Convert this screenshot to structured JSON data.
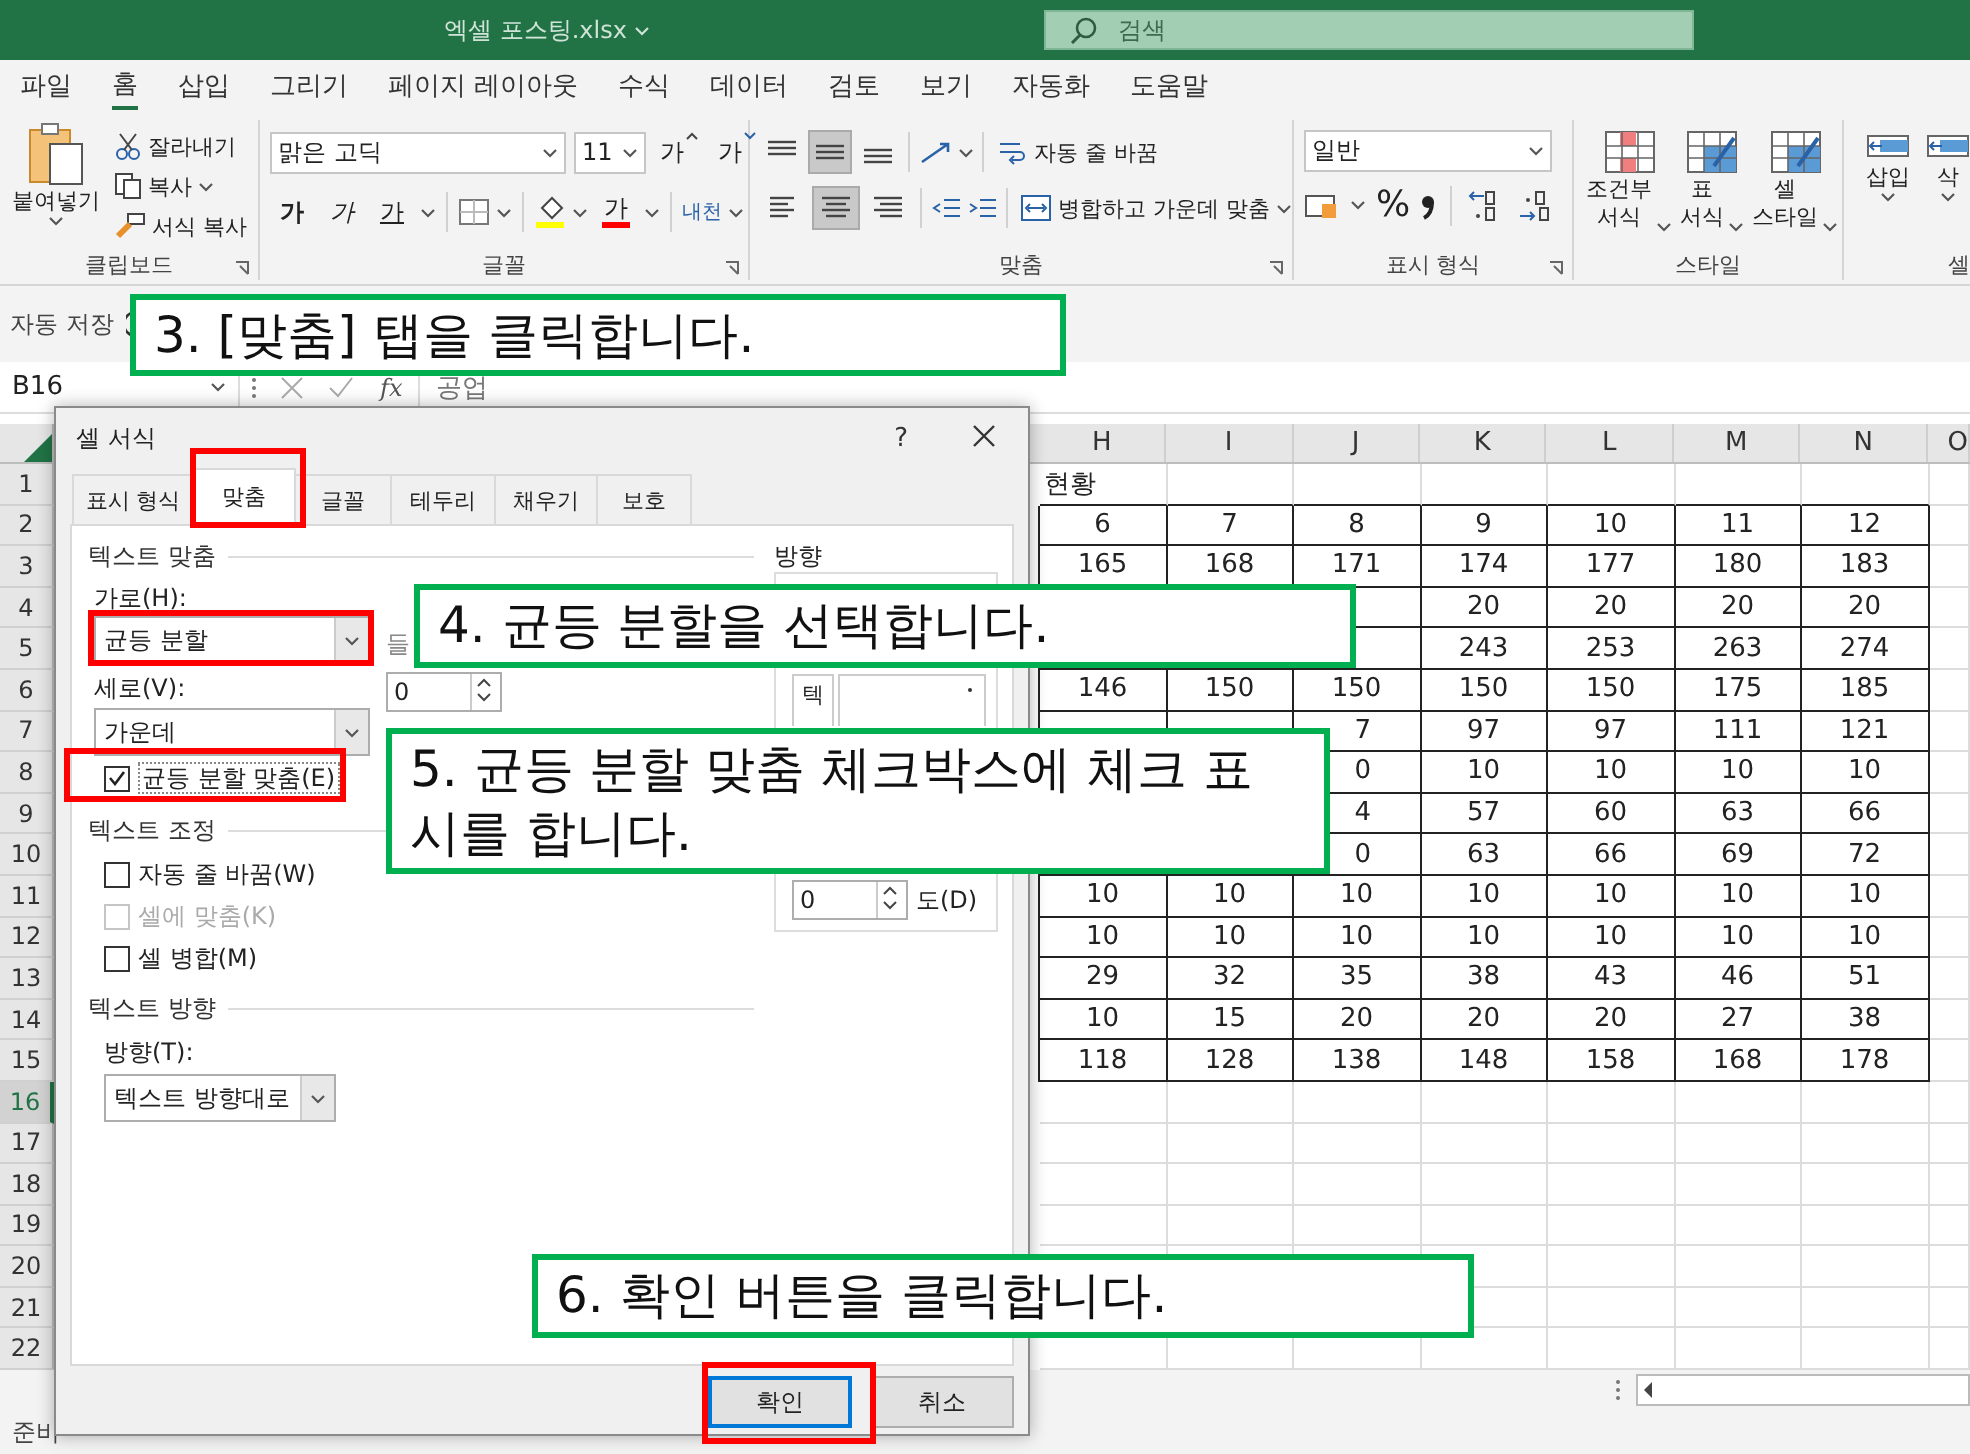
{
  "title_bar": {
    "file_name": "엑셀 포스팅.xlsx",
    "search": "검색"
  },
  "menu_tabs": [
    {
      "label": "파일",
      "selected": false
    },
    {
      "label": "홈",
      "selected": true
    },
    {
      "label": "삽입",
      "selected": false
    },
    {
      "label": "그리기",
      "selected": false
    },
    {
      "label": "페이지 레이아웃",
      "selected": false
    },
    {
      "label": "수식",
      "selected": false
    },
    {
      "label": "데이터",
      "selected": false
    },
    {
      "label": "검토",
      "selected": false
    },
    {
      "label": "보기",
      "selected": false
    },
    {
      "label": "자동화",
      "selected": false
    },
    {
      "label": "도움말",
      "selected": false
    }
  ],
  "ribbon": {
    "clipboard": {
      "label": "클립보드",
      "paste": "붙여넣기",
      "cut": "잘라내기",
      "copy": "복사",
      "format_painter": "서식 복사"
    },
    "font": {
      "label": "글꼴",
      "font_name": "맑은 고딕",
      "font_size": "11",
      "grow": "가",
      "shrink": "가",
      "bold": "가",
      "italic": "가",
      "underline": "가",
      "font_color": "가",
      "phonetic": "내천"
    },
    "alignment": {
      "label": "맞춤",
      "vertical": [
        {
          "selected": false
        },
        {
          "selected": true
        },
        {
          "selected": false
        }
      ],
      "horizontal": [
        {
          "selected": false
        },
        {
          "selected": true
        },
        {
          "selected": false
        }
      ],
      "wrap_text": "자동 줄 바꿈",
      "merge": "병합하고 가운데 맞춤"
    },
    "number": {
      "label": "표시 형식",
      "format": "일반",
      "percent": "%"
    },
    "styles": {
      "label": "스타일",
      "buttons": [
        "조건부 서식",
        "표 서식",
        "셀 스타일"
      ]
    },
    "cells": {
      "label": "셀",
      "buttons": [
        "삽입",
        "삭"
      ]
    }
  },
  "quick_access": {
    "autosave": "자동 저장"
  },
  "formula_bar": {
    "name_box": "B16",
    "function": "fx",
    "formula": "공업"
  },
  "sheet": {
    "columns": [
      "H",
      "I",
      "J",
      "K",
      "L",
      "M",
      "N",
      "O"
    ],
    "rows": [
      {
        "number": "1",
        "selected": false,
        "bordered": false,
        "cells": [
          "현황"
        ]
      },
      {
        "number": "2",
        "selected": false,
        "bordered": true,
        "cells": [
          "6",
          "7",
          "8",
          "9",
          "10",
          "11",
          "12"
        ]
      },
      {
        "number": "3",
        "selected": false,
        "bordered": true,
        "cells": [
          "165",
          "168",
          "171",
          "174",
          "177",
          "180",
          "183"
        ]
      },
      {
        "number": "4",
        "selected": false,
        "bordered": true,
        "cells": [
          null,
          null,
          null,
          "20",
          "20",
          "20",
          "20"
        ]
      },
      {
        "number": "5",
        "selected": false,
        "bordered": true,
        "cells": [
          null,
          null,
          null,
          "243",
          "253",
          "263",
          "274"
        ]
      },
      {
        "number": "6",
        "selected": false,
        "bordered": true,
        "cells": [
          "146",
          "150",
          "150",
          "150",
          "150",
          "175",
          "185"
        ]
      },
      {
        "number": "7",
        "selected": false,
        "bordered": true,
        "cells": [
          null,
          null,
          {
            "text": "7",
            "kind": "clipped"
          },
          "97",
          "97",
          "111",
          "121"
        ]
      },
      {
        "number": "8",
        "selected": false,
        "bordered": true,
        "cells": [
          null,
          null,
          {
            "text": "0",
            "kind": "clipped"
          },
          "10",
          "10",
          "10",
          "10"
        ]
      },
      {
        "number": "9",
        "selected": false,
        "bordered": true,
        "cells": [
          null,
          null,
          {
            "text": "4",
            "kind": "clipped"
          },
          "57",
          "60",
          "63",
          "66"
        ]
      },
      {
        "number": "10",
        "selected": false,
        "bordered": true,
        "cells": [
          null,
          null,
          {
            "text": "0",
            "kind": "clipped"
          },
          "63",
          "66",
          "69",
          "72"
        ]
      },
      {
        "number": "11",
        "selected": false,
        "bordered": true,
        "cells": [
          "10",
          "10",
          "10",
          "10",
          "10",
          "10",
          "10"
        ]
      },
      {
        "number": "12",
        "selected": false,
        "bordered": true,
        "cells": [
          "10",
          "10",
          "10",
          "10",
          "10",
          "10",
          "10"
        ]
      },
      {
        "number": "13",
        "selected": false,
        "bordered": true,
        "cells": [
          "29",
          "32",
          "35",
          "38",
          "43",
          "46",
          "51"
        ]
      },
      {
        "number": "14",
        "selected": false,
        "bordered": true,
        "cells": [
          "10",
          "15",
          "20",
          "20",
          "20",
          "27",
          "38"
        ]
      },
      {
        "number": "15",
        "selected": false,
        "bordered": true,
        "cells": [
          "118",
          "128",
          "138",
          "148",
          "158",
          "168",
          "178"
        ]
      },
      {
        "number": "16",
        "selected": true,
        "bordered": false
      },
      {
        "number": "17",
        "selected": false,
        "bordered": false
      },
      {
        "number": "18",
        "selected": false,
        "bordered": false
      },
      {
        "number": "19",
        "selected": false,
        "bordered": false
      },
      {
        "number": "20",
        "selected": false,
        "bordered": false
      },
      {
        "number": "21",
        "selected": false,
        "bordered": false
      },
      {
        "number": "22",
        "selected": false,
        "bordered": false
      }
    ]
  },
  "status_bar": {
    "mode": "준비"
  },
  "dialog": {
    "title": "셀 서식",
    "help": "?",
    "tabs": [
      {
        "label": "표시 형식",
        "selected": false
      },
      {
        "label": "맞춤",
        "selected": true
      },
      {
        "label": "글꼴",
        "selected": false
      },
      {
        "label": "테두리",
        "selected": false
      },
      {
        "label": "채우기",
        "selected": false
      },
      {
        "label": "보호",
        "selected": false
      }
    ],
    "text_alignment": {
      "heading": "텍스트 맞춤",
      "horizontal_label": "가로(H):",
      "horizontal_value": "균등 분할",
      "indent_label": "들",
      "indent_value": "0",
      "vertical_label": "세로(V):",
      "vertical_value": "가운데",
      "distributed": {
        "label": "균등 분할 맞춤(E)",
        "checked": true
      }
    },
    "text_control": {
      "heading": "텍스트 조정",
      "options": [
        {
          "label": "자동 줄 바꿈(W)",
          "checked": false,
          "disabled": false
        },
        {
          "label": "셀에 맞춤(K)",
          "checked": false,
          "disabled": true
        },
        {
          "label": "셀 병합(M)",
          "checked": false,
          "disabled": false
        }
      ]
    },
    "text_direction": {
      "heading": "텍스트 방향",
      "label": "방향(T):",
      "value": "텍스트 방향대로"
    },
    "orientation": {
      "heading": "방향",
      "vertical_text": "텍",
      "degrees_value": "0",
      "degrees_label": "도(D)"
    },
    "buttons": [
      {
        "label": "확인",
        "kind": "default"
      },
      {
        "label": "취소",
        "kind": "normal"
      }
    ]
  },
  "callouts": [
    {
      "text": "3. [맞춤] 탭을 클릭합니다."
    },
    {
      "text": "4. 균등 분할을 선택합니다."
    },
    {
      "text": "5. 균등 분할 맞춤 체크박스에 체크 표시를 합니다."
    },
    {
      "text": "6. 확인 버튼을 클릭합니다."
    }
  ]
}
